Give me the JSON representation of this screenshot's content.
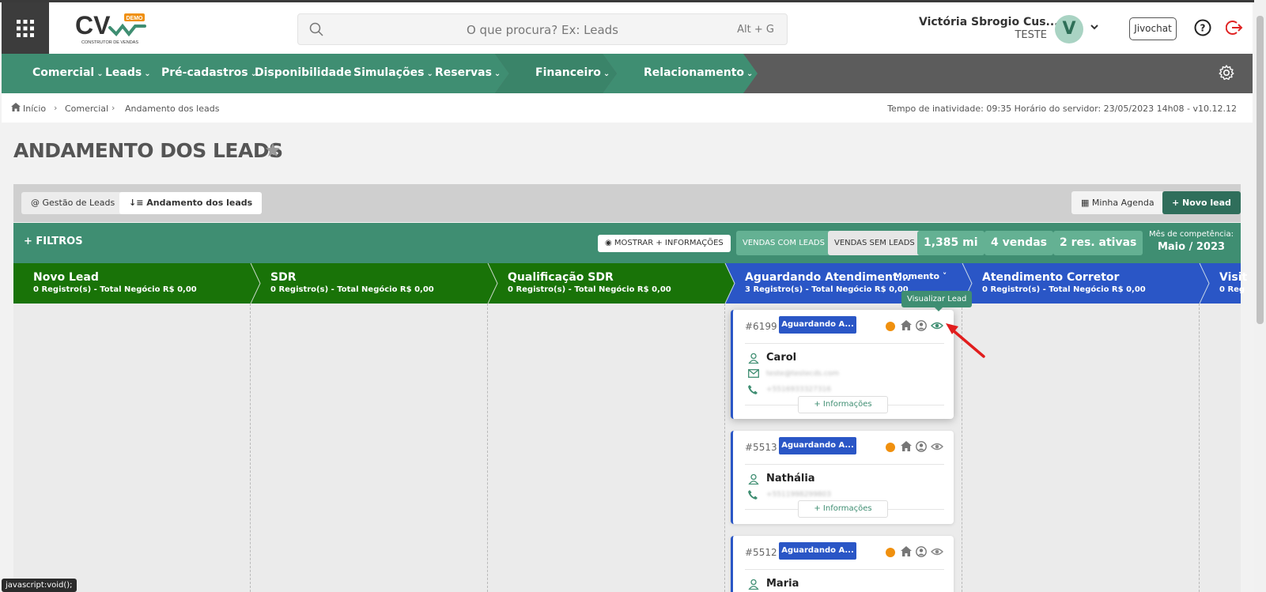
{
  "header": {
    "logo_text": "CV",
    "logo_badge": "DEMO",
    "logo_sub": "CONSTRUTOR DE VENDAS",
    "search_placeholder": "O que procura? Ex: Leads",
    "search_shortcut": "Alt + G",
    "user_name": "Victória Sbrogio Cus...",
    "user_org": "TESTE",
    "avatar_letter": "V",
    "jivochat": "Jivochat"
  },
  "nav": {
    "items": [
      {
        "label": "Comercial"
      },
      {
        "label": "Leads"
      },
      {
        "label": "Pré-cadastros"
      },
      {
        "label": "Disponibilidade"
      },
      {
        "label": "Simulações"
      },
      {
        "label": "Reservas"
      },
      {
        "label": "Financeiro"
      },
      {
        "label": "Relacionamento"
      }
    ],
    "colors": {
      "primary": "#3f8e72",
      "secondary": "#5c5c5c"
    }
  },
  "breadcrumb": {
    "items": [
      "Início",
      "Comercial",
      "Andamento dos leads"
    ],
    "server_info": "Tempo de inatividade: 09:35  Horário do servidor: 23/05/2023 14h08 - v10.12.12"
  },
  "page": {
    "title": "ANDAMENTO DOS LEADS"
  },
  "tabs": {
    "gestao": "@ Gestão de Leads",
    "andamento": "Andamento dos leads",
    "agenda": "Minha Agenda",
    "novo_lead": "Novo lead"
  },
  "filters": {
    "title": "FILTROS",
    "mostrar": "MOSTRAR + INFORMAÇÕES",
    "vendas_com_leads": "VENDAS COM LEADS",
    "vendas_sem_leads": "VENDAS SEM LEADS",
    "stat_1": "1,385 mi",
    "stat_2": "4 vendas",
    "stat_3": "2 res. ativas",
    "mes_label": "Mês de competência:",
    "mes_value": "Maio / 2023"
  },
  "stages": [
    {
      "title": "Novo Lead",
      "sub": "0 Registro(s) - Total Negócio R$ 0,00",
      "color": "#197308"
    },
    {
      "title": "SDR",
      "sub": "0 Registro(s) - Total Negócio R$ 0,00",
      "color": "#197308"
    },
    {
      "title": "Qualificação SDR",
      "sub": "0 Registro(s) - Total Negócio R$ 0,00",
      "color": "#197308"
    },
    {
      "title": "Aguardando Atendiment...",
      "sub": "3 Registro(s) - Total Negócio R$ 0,00",
      "color": "#2a56c6",
      "extra": "Momento ˅"
    },
    {
      "title": "Atendimento Corretor",
      "sub": "0 Registro(s) - Total Negócio R$ 0,00",
      "color": "#2a56c6"
    },
    {
      "title": "Visit",
      "sub": "0 Reg",
      "color": "#2a56c6"
    }
  ],
  "cards": [
    {
      "id": "#6199",
      "status": "Aguardando A...",
      "name": "Carol",
      "email": "teste@testecds.com",
      "phone": "+5516933327316",
      "info": "+ Informações"
    },
    {
      "id": "#5513",
      "status": "Aguardando A...",
      "name": "Nathália",
      "phone": "+5511998299803",
      "info": "+ Informações"
    },
    {
      "id": "#5512",
      "status": "Aguardando A...",
      "name": "Maria"
    }
  ],
  "tooltip": "Visualizar Lead",
  "status_bar": "javascript:void();"
}
